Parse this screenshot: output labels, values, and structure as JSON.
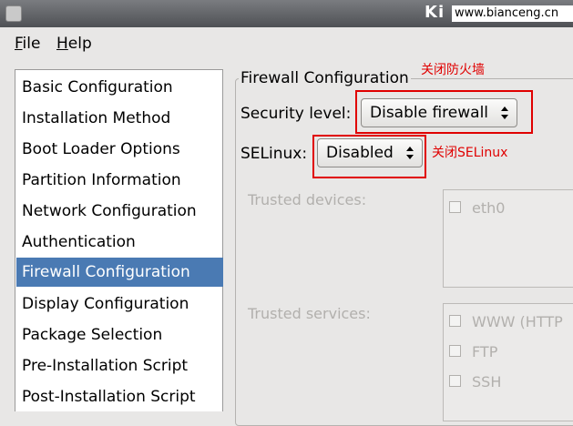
{
  "window": {
    "title_partial": "Ki",
    "watermark": "www.bianceng.cn"
  },
  "menu": {
    "file": {
      "first": "F",
      "rest": "ile"
    },
    "help": {
      "first": "H",
      "rest": "elp"
    }
  },
  "sidebar": {
    "items": [
      "Basic Configuration",
      "Installation Method",
      "Boot Loader Options",
      "Partition Information",
      "Network Configuration",
      "Authentication",
      "Firewall Configuration",
      "Display Configuration",
      "Package Selection",
      "Pre-Installation Script",
      "Post-Installation Script"
    ],
    "selected_index": 6
  },
  "firewall": {
    "frame_title": "Firewall Configuration",
    "security_level_label": "Security level:",
    "security_level_value": "Disable firewall",
    "selinux_label": "SELinux:",
    "selinux_value": "Disabled",
    "trusted_devices_label": "Trusted devices:",
    "trusted_devices": [
      "eth0"
    ],
    "trusted_services_label": "Trusted services:",
    "trusted_services": [
      "WWW (HTTP",
      "FTP",
      "SSH"
    ]
  },
  "annotations": {
    "firewall_note": "关闭防火墙",
    "selinux_note": "关闭SELinux"
  },
  "colors": {
    "selection": "#4a7ab3",
    "annotation_red": "#e00000",
    "titlebar": "#5f6165"
  }
}
